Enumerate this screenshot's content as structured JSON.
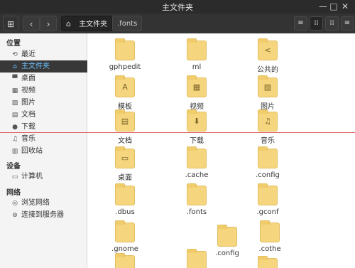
{
  "window": {
    "title": "主文件夹",
    "controls": {
      "minimize": "—",
      "maximize": "□",
      "close": "✕"
    }
  },
  "toolbar": {
    "sidebar_toggle_icon": "⊞",
    "back_icon": "‹",
    "forward_icon": "›",
    "breadcrumbs": [
      {
        "label": "主文件夹",
        "icon": "home-icon"
      },
      {
        "label": ".fonts"
      }
    ],
    "view_list_icon": "≡",
    "view_grid_icon": "⁞⁞",
    "view_columns_icon": "⁞⁞",
    "menu_icon": "≡"
  },
  "sidebar": {
    "sections": [
      {
        "title": "位置"
      },
      {
        "title": "设备"
      },
      {
        "title": "网络"
      }
    ],
    "places": [
      {
        "label": "最近",
        "icon": "clock-icon",
        "glyph": "⟲"
      },
      {
        "label": "主文件夹",
        "icon": "home-icon",
        "glyph": "⌂"
      },
      {
        "label": "桌面",
        "icon": "desktop-icon",
        "glyph": "▀"
      },
      {
        "label": "视频",
        "icon": "film-icon",
        "glyph": "▦"
      },
      {
        "label": "图片",
        "icon": "picture-icon",
        "glyph": "▨"
      },
      {
        "label": "文档",
        "icon": "document-icon",
        "glyph": "▤"
      },
      {
        "label": "下载",
        "icon": "download-icon",
        "glyph": "●"
      },
      {
        "label": "音乐",
        "icon": "music-icon",
        "glyph": "♫"
      },
      {
        "label": "回收站",
        "icon": "trash-icon",
        "glyph": "▥"
      }
    ],
    "devices": [
      {
        "label": "计算机",
        "icon": "computer-icon",
        "glyph": "▭"
      }
    ],
    "network": [
      {
        "label": "浏览网络",
        "icon": "network-icon",
        "glyph": "◎"
      },
      {
        "label": "连接到服务器",
        "icon": "server-icon",
        "glyph": "⊛"
      }
    ]
  },
  "files": [
    {
      "label": "gphpedit",
      "emblem": ""
    },
    {
      "label": "ml",
      "emblem": ""
    },
    {
      "label": "公共的",
      "emblem": "<"
    },
    {
      "label": "模板",
      "emblem": "A"
    },
    {
      "label": "视频",
      "emblem": "▦"
    },
    {
      "label": "图片",
      "emblem": "▨"
    },
    {
      "label": "文档",
      "emblem": "▤"
    },
    {
      "label": "下载",
      "emblem": "⬇"
    },
    {
      "label": "音乐",
      "emblem": "♫"
    },
    {
      "label": "桌面",
      "emblem": "▭"
    },
    {
      "label": ".cache",
      "emblem": ""
    },
    {
      "label": ".config",
      "emblem": ""
    },
    {
      "label": ".dbus",
      "emblem": ""
    },
    {
      "label": ".fonts",
      "emblem": ""
    },
    {
      "label": ".gconf",
      "emblem": ""
    },
    {
      "label": ".gnome",
      "emblem": ""
    },
    {
      "label": ".config",
      "emblem": ""
    },
    {
      "label": ".cothe",
      "emblem": ""
    },
    {
      "label": "",
      "emblem": ""
    },
    {
      "label": "",
      "emblem": ""
    },
    {
      "label": "",
      "emblem": ""
    }
  ],
  "colors": {
    "accent": "#6ac2ff",
    "folder": "#f5d67e",
    "guide_line": "#e06060"
  }
}
